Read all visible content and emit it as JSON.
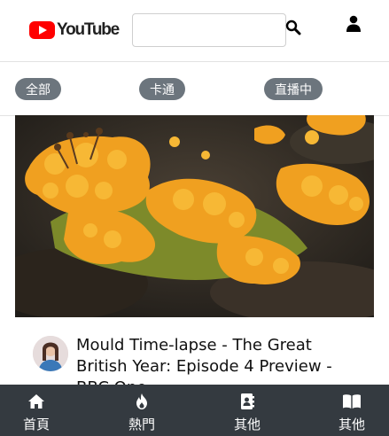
{
  "header": {
    "logo_text": "YouTube",
    "logo_color": "#ff0000",
    "search": {
      "value": "",
      "placeholder": ""
    },
    "search_icon": "search-icon",
    "user_icon": "user-icon"
  },
  "categories": [
    {
      "label": "全部"
    },
    {
      "label": "卡通"
    },
    {
      "label": "直播中"
    }
  ],
  "video": {
    "title": "Mould Time-lapse - The Great British Year: Episode 4 Preview - BBC One",
    "thumbnail": "orange-slime-mould",
    "avatar": "channel-avatar"
  },
  "bottom_nav": [
    {
      "label": "首頁",
      "icon": "home-icon"
    },
    {
      "label": "熱門",
      "icon": "fire-icon"
    },
    {
      "label": "其他",
      "icon": "contact-book-icon"
    },
    {
      "label": "其他",
      "icon": "open-book-icon"
    }
  ],
  "colors": {
    "chip_bg": "#6c757d",
    "nav_bg": "#343a40",
    "accent": "#ff0000"
  }
}
